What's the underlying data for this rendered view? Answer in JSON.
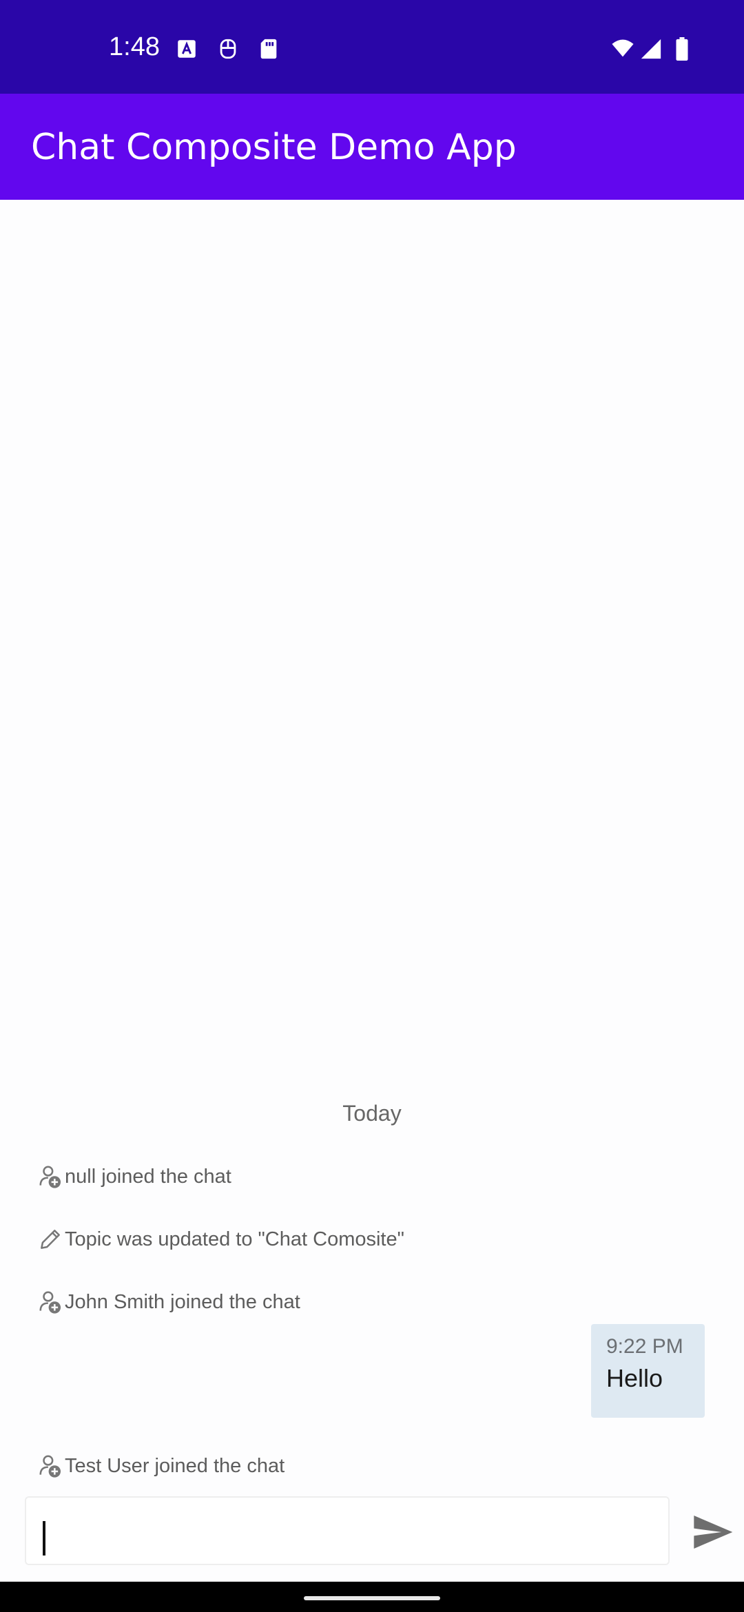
{
  "status_bar": {
    "time": "1:48",
    "icons": [
      "text-a-icon",
      "accessibility-icon",
      "sd-card-icon",
      "wifi-icon",
      "signal-icon",
      "battery-icon"
    ]
  },
  "app_bar": {
    "title": "Chat Composite Demo App",
    "background": "#6207ee"
  },
  "messages": {
    "date_separator": "Today",
    "system": [
      {
        "icon": "person-add-icon",
        "text": "null joined the chat"
      },
      {
        "icon": "pencil-icon",
        "text": "Topic was updated to \"Chat Comosite\""
      },
      {
        "icon": "person-add-icon",
        "text": "John Smith joined the chat"
      },
      {
        "icon": "person-add-icon",
        "text": "Test User joined the chat"
      }
    ],
    "outgoing": {
      "time": "9:22 PM",
      "text": "Hello"
    }
  },
  "composer": {
    "value": "",
    "send_icon": "send-icon"
  },
  "colors": {
    "status_bar": "#2a06a8",
    "app_bar": "#6207ee",
    "bubble": "#dee9f2"
  }
}
